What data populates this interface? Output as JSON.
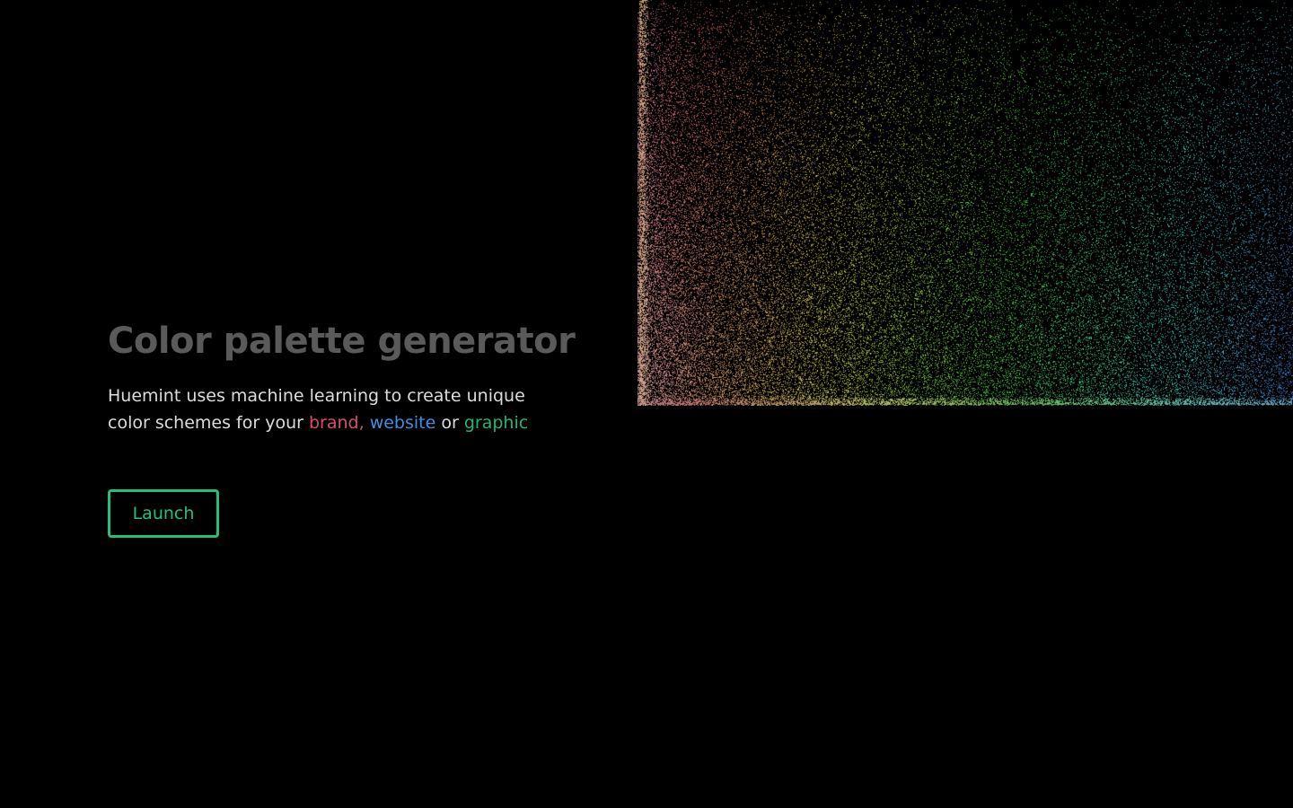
{
  "hero": {
    "title": "Color palette generator",
    "description_prefix": "Huemint uses machine learning to create unique color schemes for your",
    "keywords": {
      "brand": "brand,",
      "website": "website",
      "connector": "or",
      "graphic": "graphic"
    }
  },
  "launch_button": {
    "label": "Launch"
  },
  "colors": {
    "background": "#000000",
    "title": "#5a5a5a",
    "brand": "#d94b73",
    "website": "#3f8fe0",
    "graphic": "#22b573",
    "button_accent": "#22c07e"
  },
  "visual": {
    "icon": "color-space-particle-field"
  }
}
